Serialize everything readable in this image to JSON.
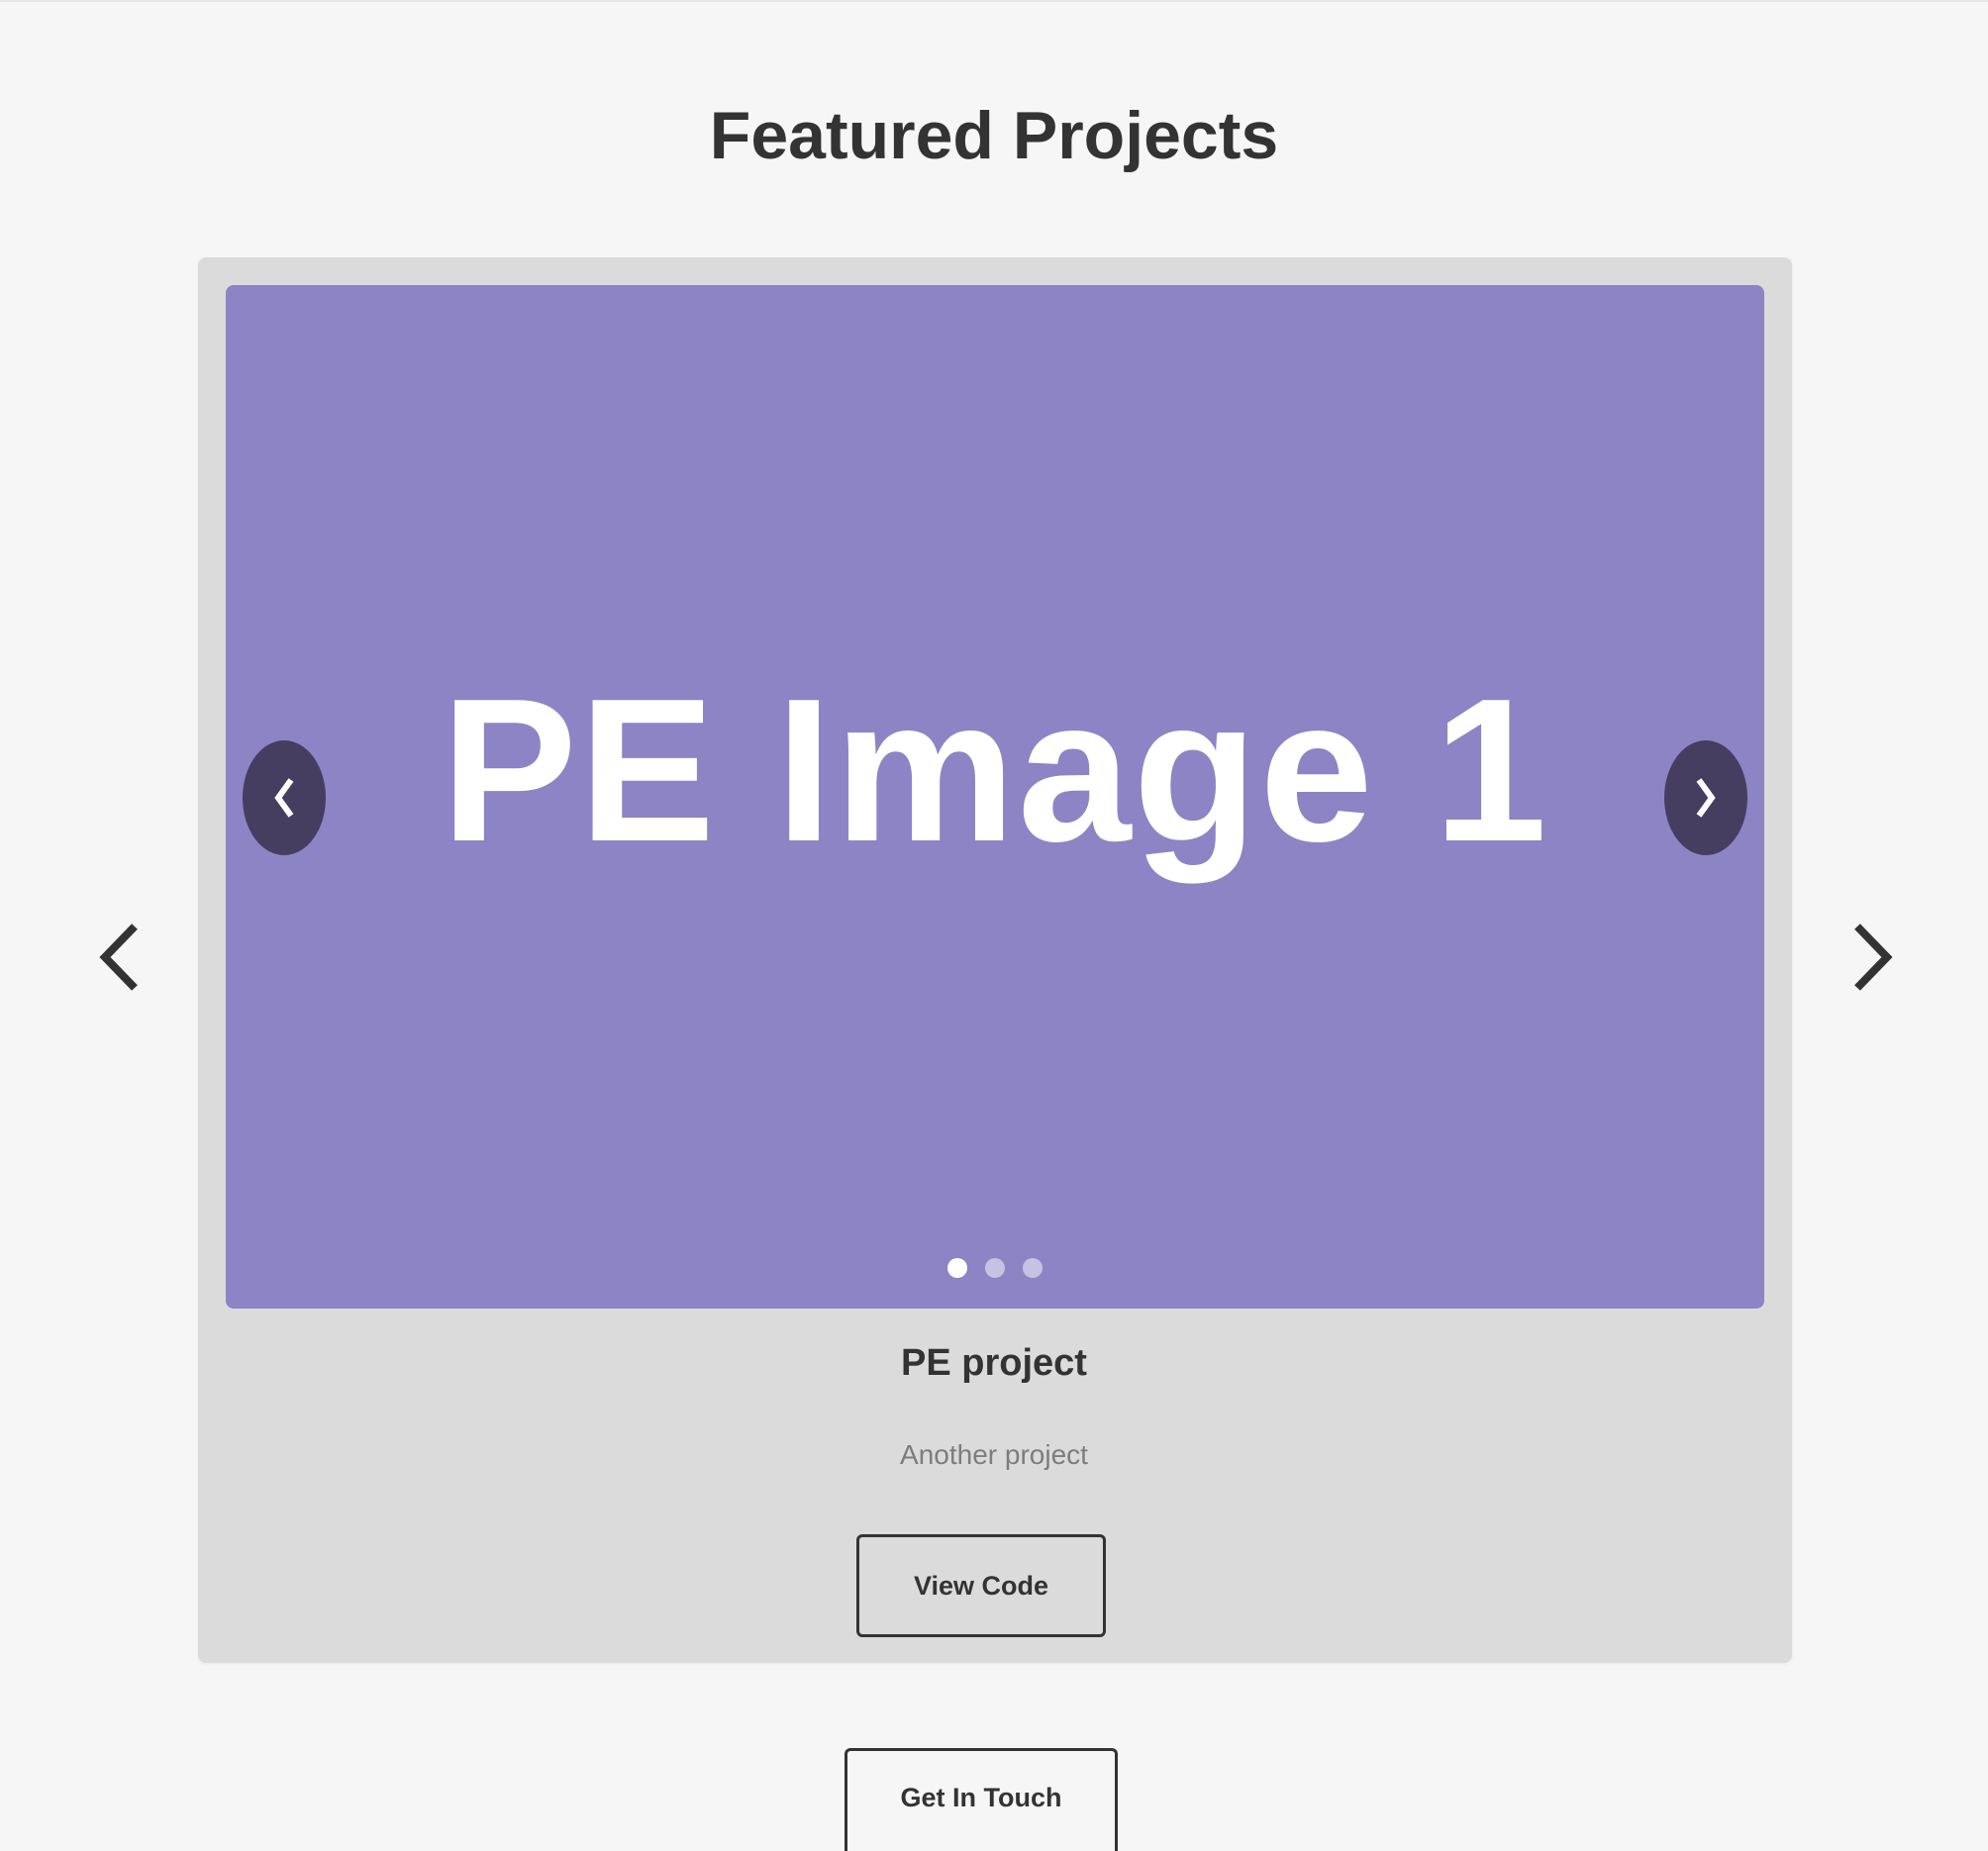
{
  "section": {
    "title": "Featured Projects"
  },
  "carousel": {
    "prev_icon": "chevron-left-icon",
    "next_icon": "chevron-right-icon"
  },
  "project": {
    "slide_image_text": "PE Image 1",
    "slide_background": "#8d84c5",
    "slide_dots_count": 3,
    "active_dot": 1,
    "title": "PE project",
    "description": "Another project",
    "view_code_label": "View Code"
  },
  "footer": {
    "contact_label": "Get In Touch"
  },
  "colors": {
    "page_background": "#f6f6f6",
    "card_background": "#dcdbdc",
    "inner_arrow_background": "#463e60",
    "text_primary": "#333333",
    "text_muted": "#7d7d7d"
  }
}
